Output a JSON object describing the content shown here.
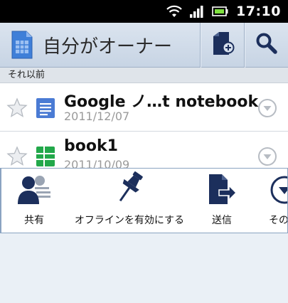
{
  "status_bar": {
    "time": "17:10"
  },
  "action_bar": {
    "title": "自分がオーナー",
    "icons": [
      "docs-app-icon",
      "new-document-icon",
      "search-icon"
    ]
  },
  "section_header": "それ以前",
  "documents": [
    {
      "name": "Google ノ…t notebook",
      "date": "2011/12/07",
      "type": "document",
      "starred": false
    },
    {
      "name": "book1",
      "date": "2011/10/09",
      "type": "spreadsheet",
      "starred": false
    }
  ],
  "quick_actions": [
    {
      "label": "共有",
      "icon": "share-icon"
    },
    {
      "label": "オフラインを有効にする",
      "icon": "pin-icon"
    },
    {
      "label": "送信",
      "icon": "send-icon"
    },
    {
      "label": "その",
      "icon": "more-icon"
    }
  ],
  "colors": {
    "action_bar": "#d3deeb",
    "accent_dark": "#1c2f5c",
    "doc_blue": "#4a7bd4",
    "sheet_green": "#22a84a"
  }
}
